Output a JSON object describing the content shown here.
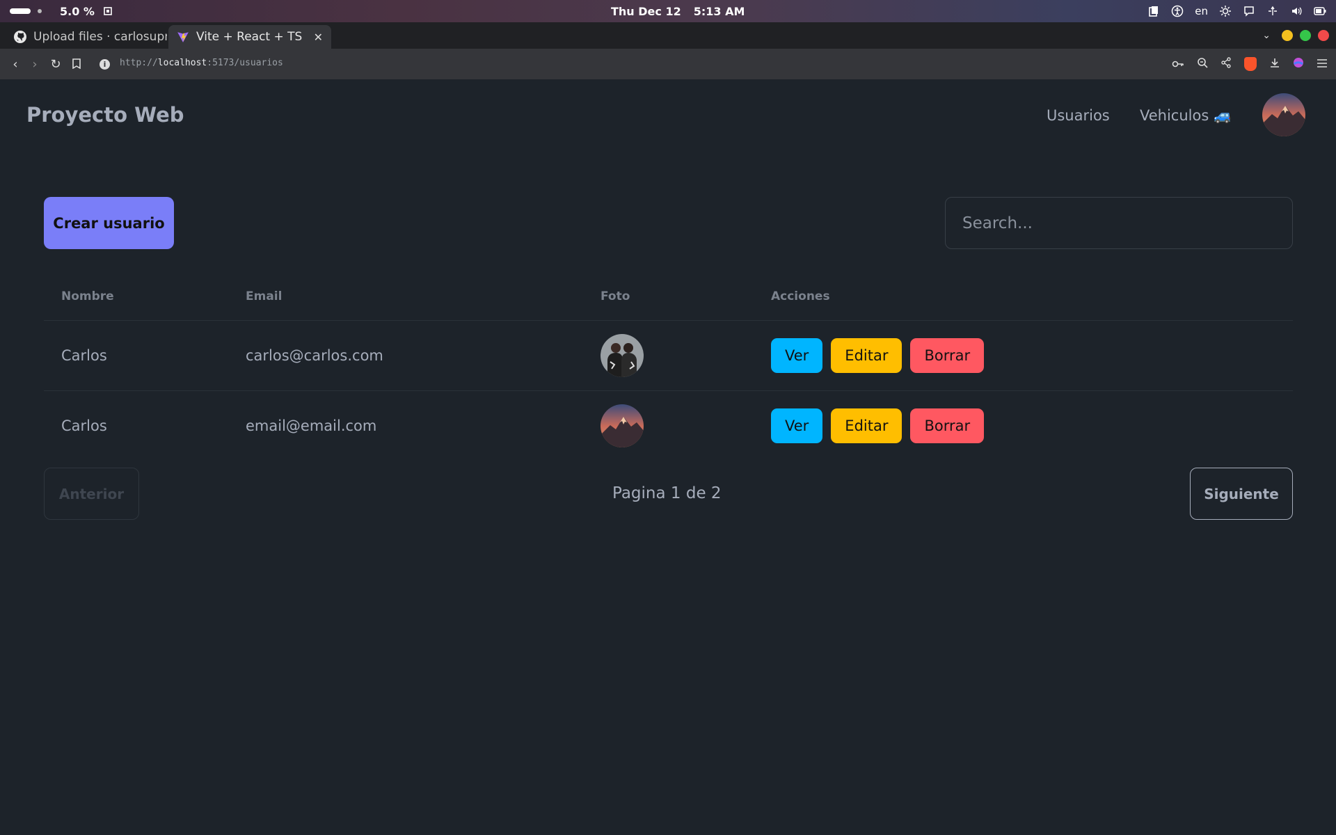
{
  "os": {
    "cpu": "5.0 %",
    "date": "Thu Dec 12",
    "time": "5:13 AM",
    "lang": "en"
  },
  "browser": {
    "tabs": [
      {
        "title": "Upload files · carlosupre",
        "active": false
      },
      {
        "title": "Vite + React + TS",
        "active": true
      }
    ],
    "url_scheme": "http://",
    "url_host": "localhost",
    "url_path": ":5173/usuarios"
  },
  "app": {
    "brand": "Proyecto Web",
    "nav": {
      "usuarios": "Usuarios",
      "vehiculos": "Vehiculos 🚙"
    },
    "create_label": "Crear usuario",
    "search_placeholder": "Search...",
    "columns": [
      "Nombre",
      "Email",
      "Foto",
      "Acciones"
    ],
    "rows": [
      {
        "nombre": "Carlos",
        "email": "carlos@carlos.com",
        "photo": "couple-photo"
      },
      {
        "nombre": "Carlos",
        "email": "email@email.com",
        "photo": "mountain-photo"
      }
    ],
    "actions": {
      "ver": "Ver",
      "editar": "Editar",
      "borrar": "Borrar"
    },
    "pagination": {
      "prev": "Anterior",
      "info": "Pagina 1 de 2",
      "next": "Siguiente"
    }
  },
  "colors": {
    "background": "#1d232a",
    "primary": "#7a7ef8",
    "info": "#00b5ff",
    "warning": "#ffbe00",
    "error": "#ff5861"
  }
}
